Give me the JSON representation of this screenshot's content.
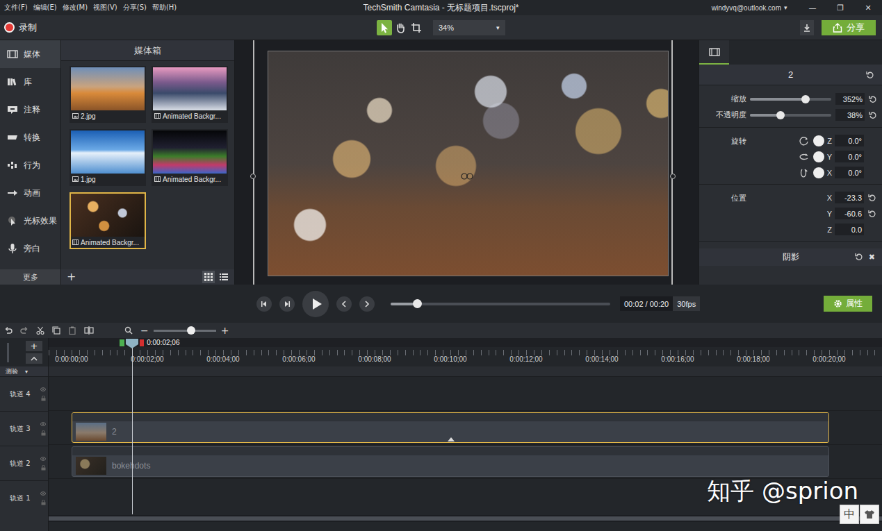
{
  "window": {
    "title": "TechSmith Camtasia - 无标题项目.tscproj*",
    "account": "windyvq@outlook.com",
    "account_arrow": "▾",
    "controls": [
      "—",
      "❐",
      "✕"
    ]
  },
  "menu": [
    "文件(F)",
    "编辑(E)",
    "修改(M)",
    "视图(V)",
    "分享(S)",
    "帮助(H)"
  ],
  "toolbar": {
    "record": "录制",
    "tools": [
      {
        "kind": "select",
        "selected": true
      },
      {
        "kind": "pan",
        "selected": false
      },
      {
        "kind": "crop",
        "selected": false
      }
    ],
    "zoom": "34%",
    "zoom_arrow": "▾",
    "share": "分享"
  },
  "sidebar": {
    "items": [
      {
        "label": "媒体",
        "kind": "media",
        "selected": true
      },
      {
        "label": "库",
        "kind": "library",
        "selected": false
      },
      {
        "label": "注释",
        "kind": "annotation",
        "selected": false
      },
      {
        "label": "转换",
        "kind": "transition",
        "selected": false
      },
      {
        "label": "行为",
        "kind": "behavior",
        "selected": false
      },
      {
        "label": "动画",
        "kind": "animation",
        "selected": false
      },
      {
        "label": "光标效果",
        "kind": "cursor",
        "selected": false
      },
      {
        "label": "旁白",
        "kind": "narration",
        "selected": false
      }
    ],
    "more": "更多"
  },
  "media_bin": {
    "title": "媒体箱",
    "items": [
      {
        "label": "2.jpg",
        "kind": "image",
        "selected": false
      },
      {
        "label": "Animated Backgr...",
        "kind": "video",
        "selected": false
      },
      {
        "label": "1.jpg",
        "kind": "image",
        "selected": false
      },
      {
        "label": "Animated Backgr...",
        "kind": "video",
        "selected": false
      },
      {
        "label": "Animated Backgr...",
        "kind": "video",
        "selected": true
      }
    ],
    "add": "+",
    "views": [
      {
        "kind": "grid",
        "selected": true
      },
      {
        "kind": "list",
        "selected": false
      }
    ]
  },
  "properties": {
    "title": "2",
    "sliders": [
      {
        "label": "缩放",
        "level": 0.68,
        "value": "352%"
      },
      {
        "label": "不透明度",
        "level": 0.38,
        "value": "38%"
      }
    ],
    "rotation": {
      "label": "旋转",
      "axes": [
        {
          "axis": "Z",
          "value": "0.0°"
        },
        {
          "axis": "Y",
          "value": "0.0°"
        },
        {
          "axis": "X",
          "value": "0.0°"
        }
      ]
    },
    "position": {
      "label": "位置",
      "axes": [
        {
          "axis": "X",
          "value": "-23.3",
          "resettable": true
        },
        {
          "axis": "Y",
          "value": "-60.6",
          "resettable": true
        },
        {
          "axis": "Z",
          "value": "0.0",
          "resettable": false
        }
      ]
    },
    "shadow": {
      "label": "阴影",
      "close": "✖"
    }
  },
  "playback": {
    "time": "00:02 / 00:20",
    "fps": "30fps",
    "level": 0.12,
    "properties": "属性"
  },
  "timeline": {
    "zoom_minus": "−",
    "zoom_plus": "+",
    "zoom_level": 0.6,
    "add_track": "+",
    "playhead": {
      "label": "0:00:02;06",
      "level": 0.08
    },
    "ticks": [
      "0:00:00;00",
      "0:00:02;00",
      "0:00:04;00",
      "0:00:06;00",
      "0:00:08;00",
      "0:00:10;00",
      "0:00:12;00",
      "0:00:14;00",
      "0:00:16;00",
      "0:00:18;00",
      "0:00:20;00"
    ],
    "quiz": "测验",
    "quiz_arrow": "▾",
    "tracks": [
      {
        "label": "轨道 4",
        "clip": null
      },
      {
        "label": "轨道 3",
        "clip": {
          "label": "2",
          "kind": "image",
          "selected": true
        }
      },
      {
        "label": "轨道 2",
        "clip": {
          "label": "bokehdots",
          "kind": "video",
          "selected": false
        }
      },
      {
        "label": "轨道 1",
        "clip": null
      }
    ]
  },
  "watermark": "知乎 @sprion",
  "ime": "中"
}
